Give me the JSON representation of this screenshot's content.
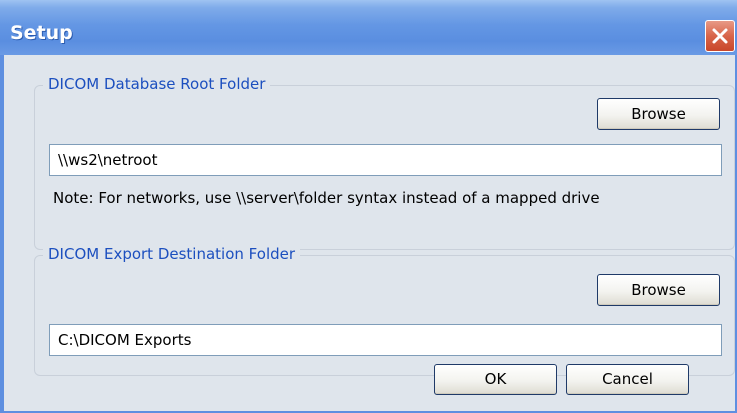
{
  "window": {
    "title": "Setup",
    "close_icon": "close-icon"
  },
  "database_group": {
    "legend": "DICOM Database Root Folder",
    "browse_label": "Browse",
    "path_value": "\\\\ws2\\netroot",
    "note": "Note: For networks, use \\\\server\\folder syntax instead of a mapped drive"
  },
  "export_group": {
    "legend": "DICOM Export Destination Folder",
    "browse_label": "Browse",
    "path_value": "C:\\DICOM Exports"
  },
  "footer": {
    "ok_label": "OK",
    "cancel_label": "Cancel"
  },
  "colors": {
    "titlebar": "#5a8ee0",
    "legend_text": "#1c4fbf",
    "client_bg": "#dfe5ec",
    "close_button": "#d8654a"
  }
}
